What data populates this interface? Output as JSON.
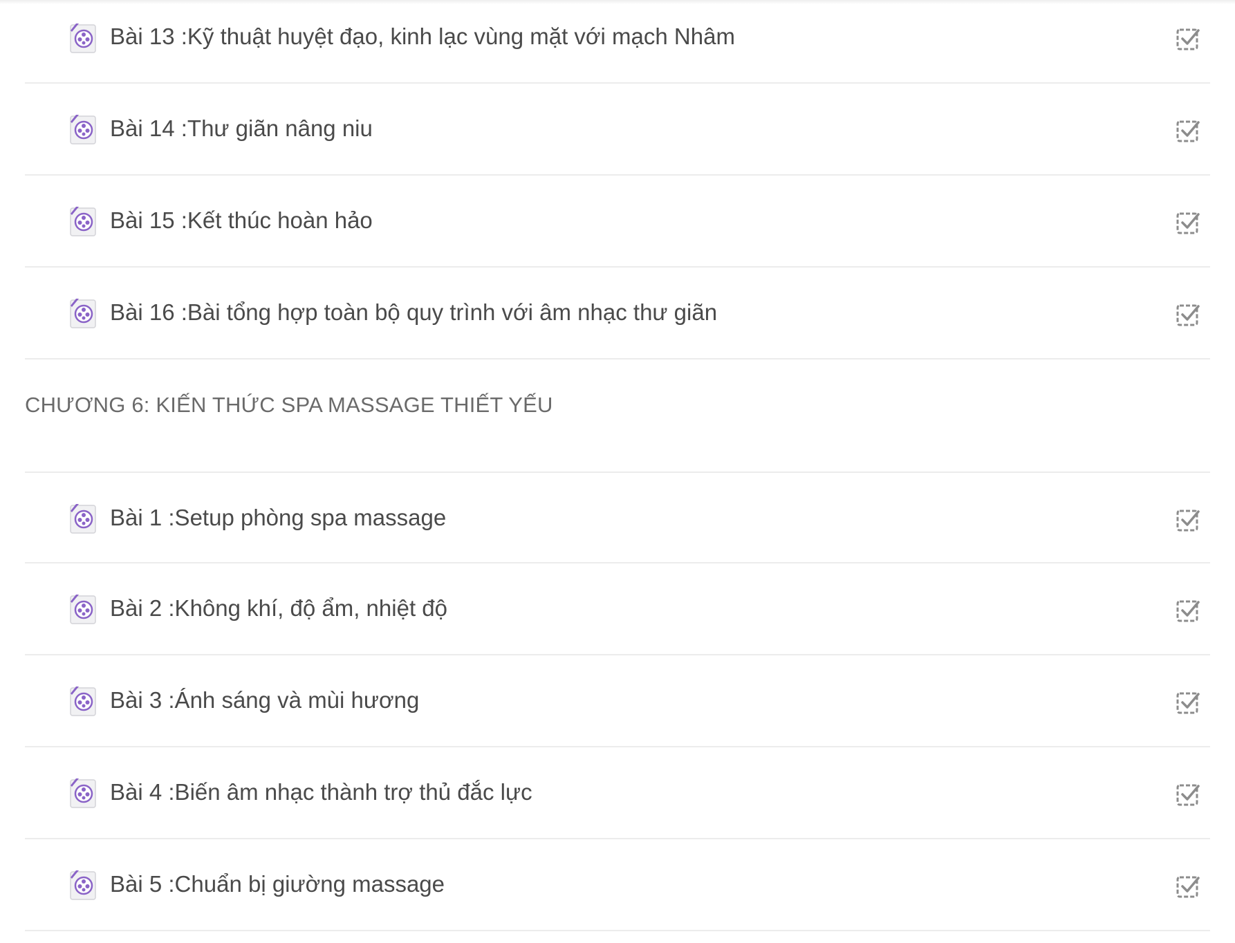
{
  "sections": [
    {
      "chapter_title": "",
      "lessons": [
        {
          "title": "Bài 13 :Kỹ thuật huyệt đạo, kinh lạc vùng mặt với mạch Nhâm"
        },
        {
          "title": "Bài 14 :Thư giãn nâng niu"
        },
        {
          "title": "Bài 15 :Kết thúc hoàn hảo"
        },
        {
          "title": "Bài 16 :Bài tổng hợp toàn bộ quy trình với âm nhạc thư giãn"
        }
      ]
    },
    {
      "chapter_title": "CHƯƠNG 6: KIẾN THỨC SPA MASSAGE THIẾT YẾU",
      "lessons": [
        {
          "title": "Bài 1 :Setup phòng spa massage"
        },
        {
          "title": "Bài 2 :Không khí, độ ẩm, nhiệt độ"
        },
        {
          "title": "Bài 3 :Ánh sáng và mùi hương"
        },
        {
          "title": "Bài 4 :Biến âm nhạc thành trợ thủ đắc lực"
        },
        {
          "title": "Bài 5 :Chuẩn bị giường massage"
        }
      ]
    }
  ],
  "icons": {
    "lesson": "video-file-icon",
    "status": "checkbox-checked-icon"
  },
  "colors": {
    "accent": "#8a63c7",
    "text": "#4a4a4a",
    "chapter_text": "#6a6a6a",
    "divider": "#ececec",
    "check": "#8c8c8c"
  }
}
